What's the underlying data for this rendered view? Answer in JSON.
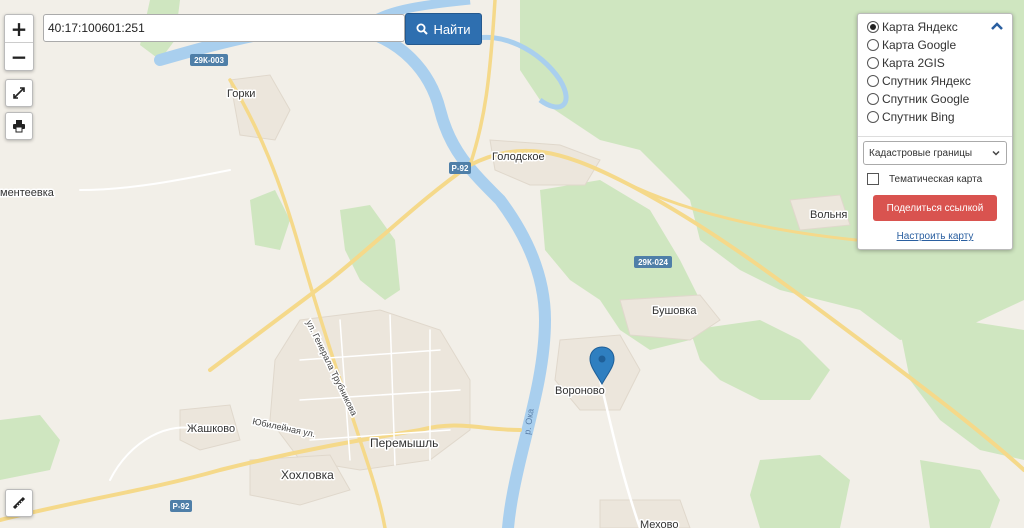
{
  "search": {
    "value": "40:17:100601:251",
    "button_label": "Найти"
  },
  "controls": {
    "zoom_in": "+",
    "zoom_out": "−"
  },
  "layers": {
    "options": [
      {
        "label": "Карта Яндекс",
        "selected": true
      },
      {
        "label": "Карта Google",
        "selected": false
      },
      {
        "label": "Карта 2GIS",
        "selected": false
      },
      {
        "label": "Спутник Яндекс",
        "selected": false
      },
      {
        "label": "Спутник Google",
        "selected": false
      },
      {
        "label": "Спутник Bing",
        "selected": false
      }
    ],
    "overlay_select": "Кадастровые границы",
    "thematic_label": "Тематическая карта",
    "thematic_checked": false,
    "share_button": "Поделиться ссылкой",
    "configure_link": "Настроить карту"
  },
  "map": {
    "places": {
      "gorki": "Горки",
      "golodskoe": "Голодское",
      "mentееevka": "ментеевка",
      "volnya": "Вольня",
      "bushovka": "Бушовка",
      "voronovo": "Вороново",
      "zhashkovo": "Жашково",
      "peremyshl": "Перемышль",
      "khokhlovka": "Хохловка",
      "mekhovo": "Мехово"
    },
    "streets": {
      "trubnikova": "ул. Генерала Трубникова",
      "yubileynaya": "Юбилейная ул."
    },
    "river": "р. Ока",
    "road_shields": {
      "s1": "29К-003",
      "s2": "Р-92",
      "s3": "29К-024",
      "s4": "Р-92"
    },
    "colors": {
      "background": "#f2efe8",
      "forest": "#cfe6c0",
      "water": "#a9cfee",
      "road": "#f5d98a",
      "marker": "#2f7fc0"
    }
  }
}
